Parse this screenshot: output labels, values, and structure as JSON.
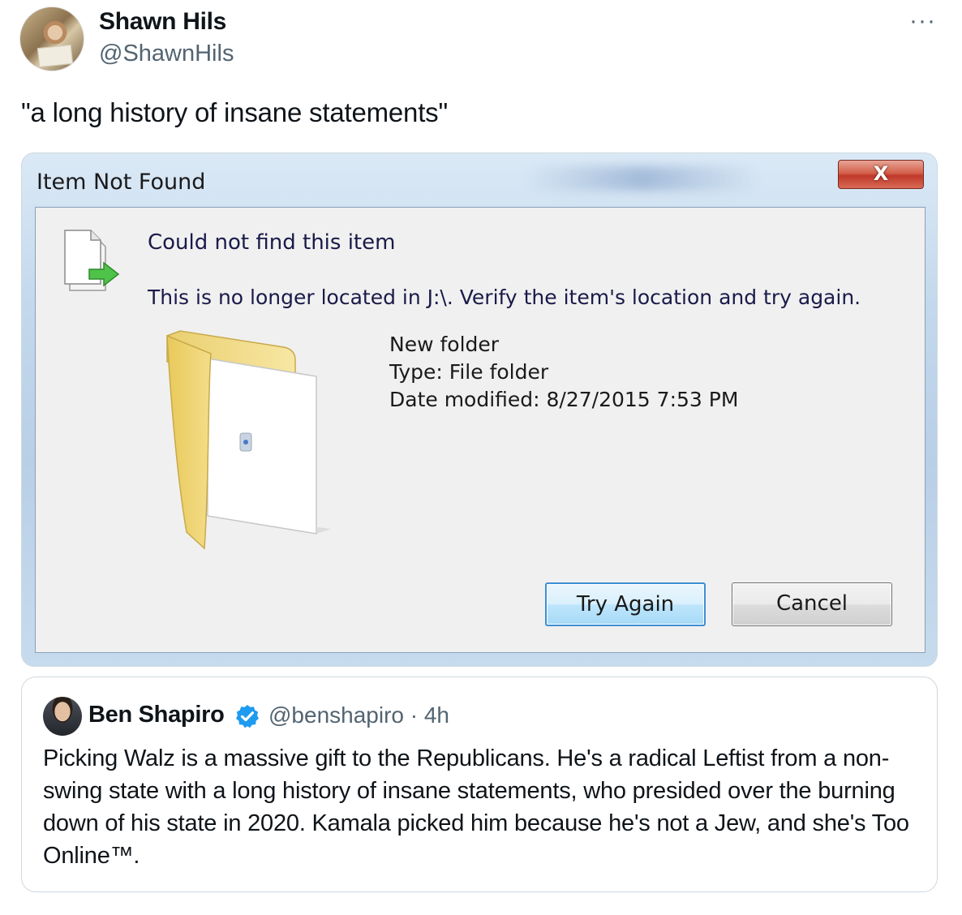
{
  "post": {
    "author_name": "Shawn Hils",
    "author_handle": "@ShawnHils",
    "more_label": "···",
    "text": "\"a long history of insane statements\""
  },
  "dialog": {
    "title": "Item Not Found",
    "close_label": "X",
    "message_title": "Could not find this item",
    "message_detail": "This is no longer located in J:\\. Verify the item's location and try again.",
    "item_name": "New folder",
    "item_type": "Type: File folder",
    "item_date": "Date modified: 8/27/2015 7:53 PM",
    "try_again_label": "Try Again",
    "cancel_label": "Cancel"
  },
  "quote": {
    "author_name": "Ben Shapiro",
    "author_handle": "@benshapiro · 4h",
    "verified": true,
    "text": "Picking Walz is a massive gift to the Republicans. He's a radical Leftist from a non-swing state with a long history of insane statements, who presided over the burning down of his state in 2020. Kamala picked him because he's not a Jew, and she's Too Online™."
  },
  "colors": {
    "text_primary": "#0f1419",
    "text_secondary": "#536471",
    "verified_blue": "#1d9bf0",
    "border": "#cfd9de"
  }
}
